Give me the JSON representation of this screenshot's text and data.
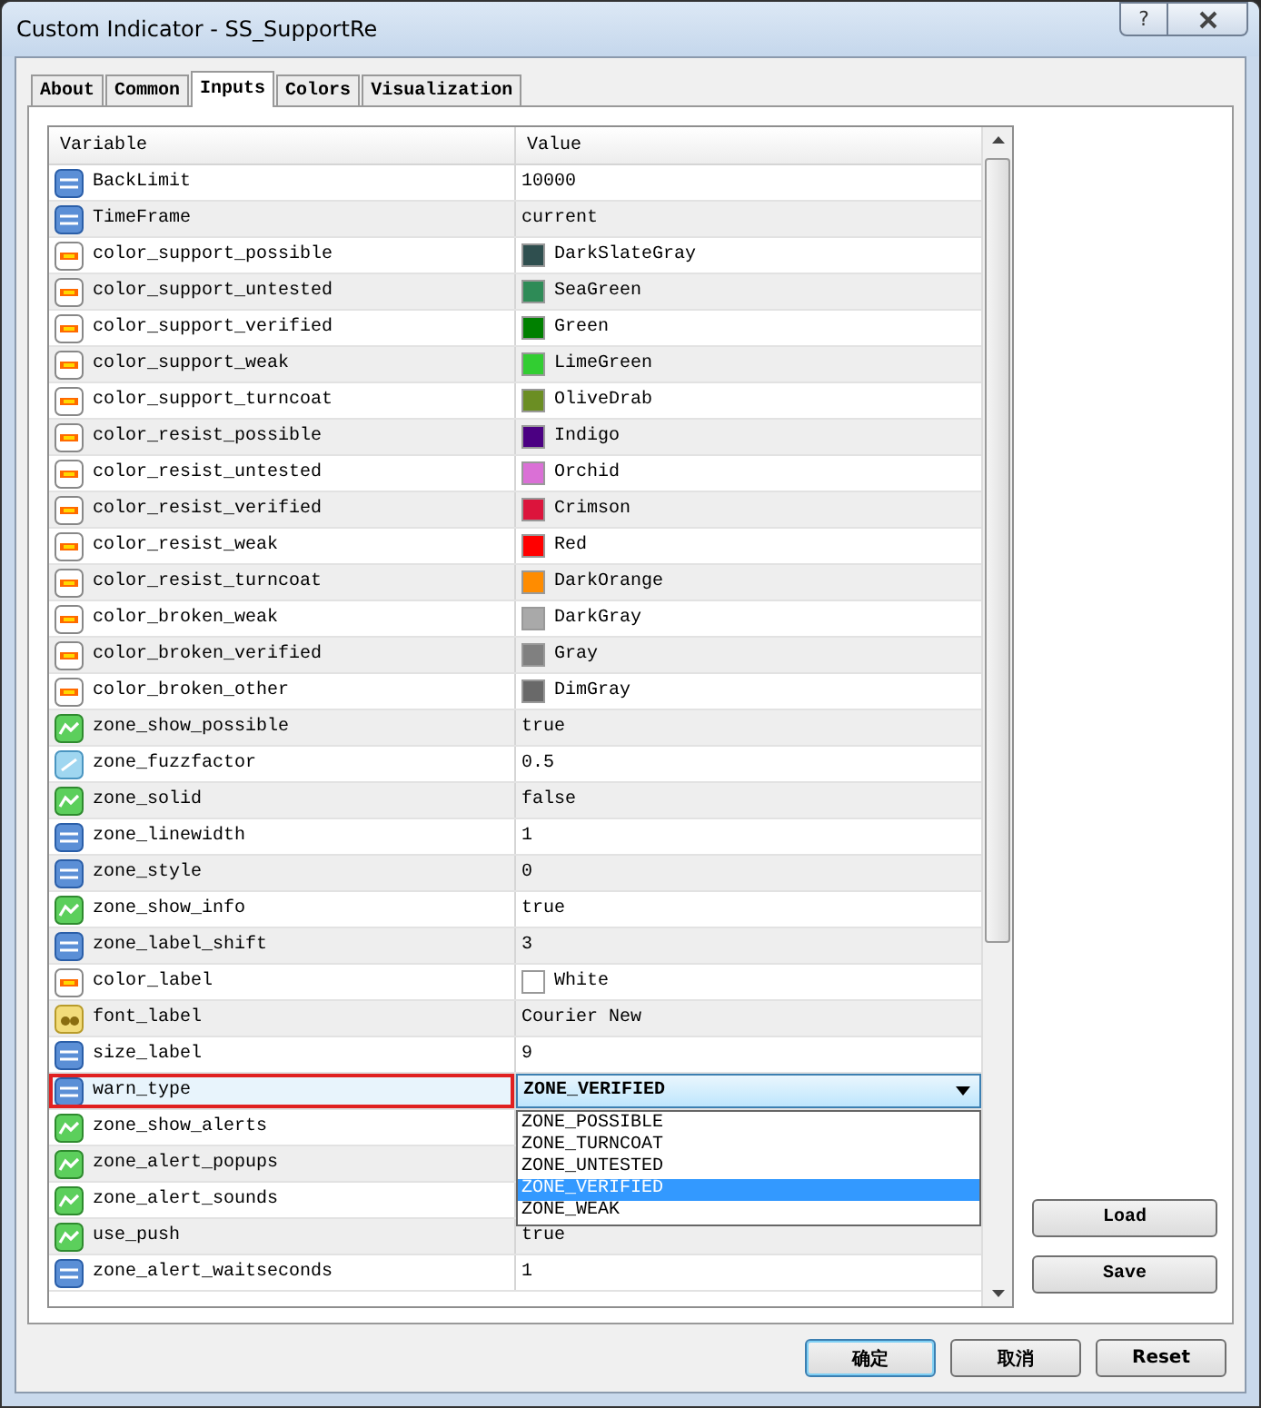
{
  "window": {
    "title": "Custom Indicator - SS_SupportRe",
    "help": "?"
  },
  "tabs": [
    {
      "label": "About",
      "selected": false
    },
    {
      "label": "Common",
      "selected": false
    },
    {
      "label": "Inputs",
      "selected": true
    },
    {
      "label": "Colors",
      "selected": false
    },
    {
      "label": "Visualization",
      "selected": false
    }
  ],
  "table": {
    "columns": [
      "Variable",
      "Value"
    ],
    "rows": [
      {
        "kind": "int",
        "name": "BackLimit",
        "value": "10000",
        "selected": false
      },
      {
        "kind": "int",
        "name": "TimeFrame",
        "value": "current",
        "selected": false
      },
      {
        "kind": "color",
        "name": "color_support_possible",
        "value": "DarkSlateGray",
        "color": "#2f4f4f",
        "selected": false
      },
      {
        "kind": "color",
        "name": "color_support_untested",
        "value": "SeaGreen",
        "color": "#2e8b57",
        "selected": false
      },
      {
        "kind": "color",
        "name": "color_support_verified",
        "value": "Green",
        "color": "#008000",
        "selected": false
      },
      {
        "kind": "color",
        "name": "color_support_weak",
        "value": "LimeGreen",
        "color": "#32cd32",
        "selected": false
      },
      {
        "kind": "color",
        "name": "color_support_turncoat",
        "value": "OliveDrab",
        "color": "#6b8e23",
        "selected": false
      },
      {
        "kind": "color",
        "name": "color_resist_possible",
        "value": "Indigo",
        "color": "#4b0082",
        "selected": false
      },
      {
        "kind": "color",
        "name": "color_resist_untested",
        "value": "Orchid",
        "color": "#da70d6",
        "selected": false
      },
      {
        "kind": "color",
        "name": "color_resist_verified",
        "value": "Crimson",
        "color": "#dc143c",
        "selected": false
      },
      {
        "kind": "color",
        "name": "color_resist_weak",
        "value": "Red",
        "color": "#ff0000",
        "selected": false
      },
      {
        "kind": "color",
        "name": "color_resist_turncoat",
        "value": "DarkOrange",
        "color": "#ff8c00",
        "selected": false
      },
      {
        "kind": "color",
        "name": "color_broken_weak",
        "value": "DarkGray",
        "color": "#a9a9a9",
        "selected": false
      },
      {
        "kind": "color",
        "name": "color_broken_verified",
        "value": "Gray",
        "color": "#808080",
        "selected": false
      },
      {
        "kind": "color",
        "name": "color_broken_other",
        "value": "DimGray",
        "color": "#696969",
        "selected": false
      },
      {
        "kind": "bool",
        "name": "zone_show_possible",
        "value": "true",
        "selected": false
      },
      {
        "kind": "double",
        "name": "zone_fuzzfactor",
        "value": "0.5",
        "selected": false
      },
      {
        "kind": "bool",
        "name": "zone_solid",
        "value": "false",
        "selected": false
      },
      {
        "kind": "int",
        "name": "zone_linewidth",
        "value": "1",
        "selected": false
      },
      {
        "kind": "int",
        "name": "zone_style",
        "value": "0",
        "selected": false
      },
      {
        "kind": "bool",
        "name": "zone_show_info",
        "value": "true",
        "selected": false
      },
      {
        "kind": "int",
        "name": "zone_label_shift",
        "value": "3",
        "selected": false
      },
      {
        "kind": "color",
        "name": "color_label",
        "value": "White",
        "color": "#ffffff",
        "selected": false
      },
      {
        "kind": "string",
        "name": "font_label",
        "value": "Courier New",
        "selected": false
      },
      {
        "kind": "int",
        "name": "size_label",
        "value": "9",
        "selected": false
      },
      {
        "kind": "int",
        "name": "warn_type",
        "value": "ZONE_VERIFIED",
        "selected": true,
        "options": [
          {
            "label": "ZONE_POSSIBLE",
            "selected": false
          },
          {
            "label": "ZONE_TURNCOAT",
            "selected": false
          },
          {
            "label": "ZONE_UNTESTED",
            "selected": false
          },
          {
            "label": "ZONE_VERIFIED",
            "selected": true
          },
          {
            "label": "ZONE_WEAK",
            "selected": false
          }
        ]
      },
      {
        "kind": "bool",
        "name": "zone_show_alerts",
        "selected": false
      },
      {
        "kind": "bool",
        "name": "zone_alert_popups",
        "selected": false
      },
      {
        "kind": "bool",
        "name": "zone_alert_sounds",
        "selected": false
      },
      {
        "kind": "bool",
        "name": "use_push",
        "value": "true",
        "selected": false
      },
      {
        "kind": "int",
        "name": "zone_alert_waitseconds",
        "value": "1",
        "selected": false
      }
    ]
  },
  "side_buttons": [
    "Load",
    "Save"
  ],
  "buttons": [
    {
      "label": "确定",
      "default": true
    },
    {
      "label": "取消",
      "default": false
    },
    {
      "label": "Reset",
      "default": false
    }
  ]
}
